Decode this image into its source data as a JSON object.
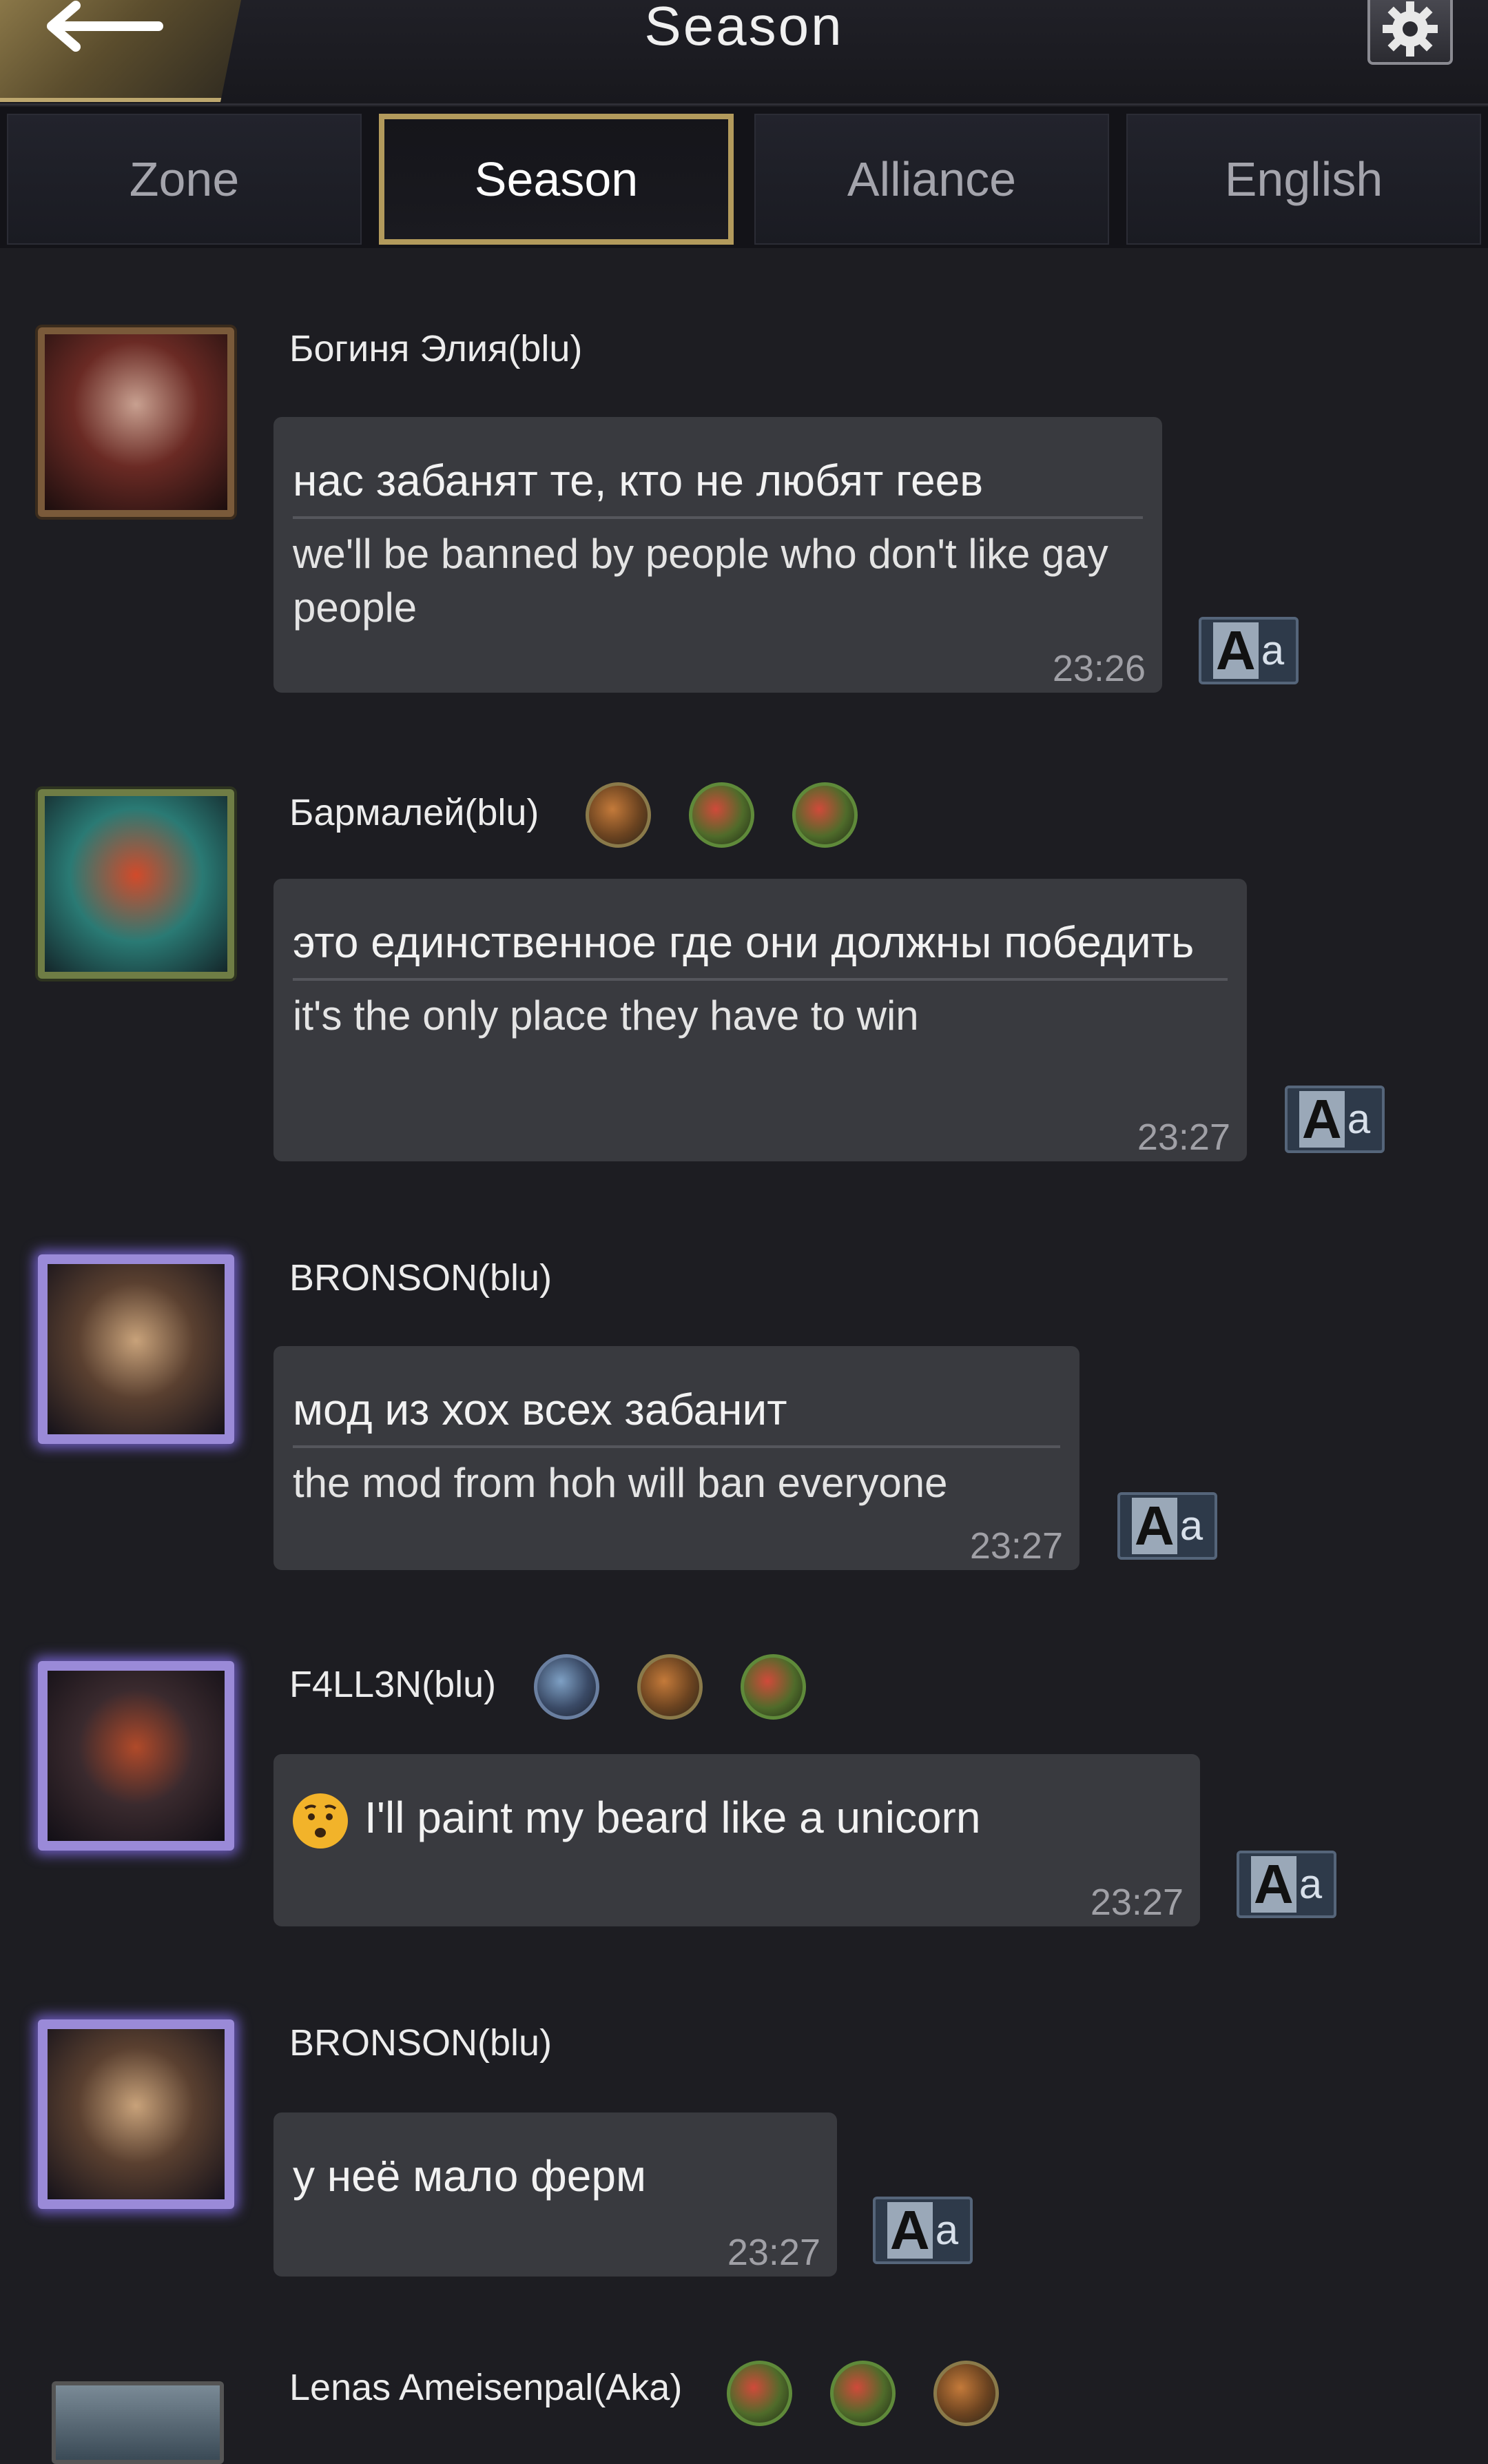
{
  "header": {
    "title": "Season"
  },
  "tabs": [
    {
      "label": "Zone",
      "active": false
    },
    {
      "label": "Season",
      "active": true
    },
    {
      "label": "Alliance",
      "active": false
    },
    {
      "label": "English",
      "active": false
    }
  ],
  "messages": [
    {
      "sender": "Богиня Элия(blu)",
      "original": "нас забанят те, кто не любят геев",
      "translation": "we'll be banned by people who don't like gay people",
      "time": "23:26"
    },
    {
      "sender": "Бармалей(blu)",
      "original": "это единственное где они должны победить",
      "translation": "it's the only place they have to win",
      "time": "23:27"
    },
    {
      "sender": "BRONSON(blu)",
      "original": "мод из хох всех забанит",
      "translation": "the mod from hoh will ban everyone",
      "time": "23:27"
    },
    {
      "sender": "F4LL3N(blu)",
      "original": "I'll paint my beard like a unicorn",
      "time": "23:27",
      "emoji": "worried-face-icon"
    },
    {
      "sender": "BRONSON(blu)",
      "original": "у неё мало ферм",
      "time": "23:27"
    },
    {
      "sender": "Lenas Ameisenpal(Aka)"
    }
  ],
  "translate_button": {
    "big": "A",
    "small": "a"
  },
  "colors": {
    "background": "#1d1d22",
    "bubble": "#393a3f",
    "active_tab_border": "#b29a5c"
  }
}
